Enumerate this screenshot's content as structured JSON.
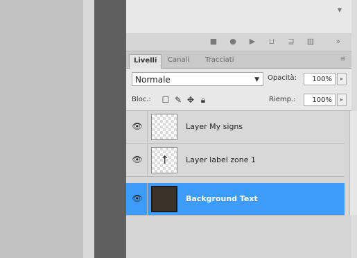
{
  "layers_panel": {
    "tabs": [
      {
        "label": "Livelli"
      },
      {
        "label": "Canali"
      },
      {
        "label": "Tracciati"
      }
    ],
    "blend_mode": "Normale",
    "opacity_label": "Opacità:",
    "opacity_value": "100%",
    "lock_label": "Bloc.:",
    "fill_label": "Riemp.:",
    "fill_value": "100%",
    "layers": [
      {
        "name": "Layer My signs",
        "visible": true,
        "selected": false
      },
      {
        "name": "Layer label zone 1",
        "visible": true,
        "selected": false
      },
      {
        "name": "Background Text",
        "visible": true,
        "selected": true
      }
    ]
  },
  "colors": {
    "selection": "#3d9bfa",
    "dark_bar": "#5f5f5f",
    "canvas": "#c2c2c2"
  }
}
